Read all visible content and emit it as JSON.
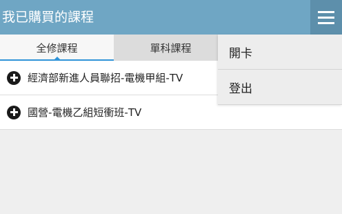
{
  "appbar": {
    "title": "我已購買的課程",
    "menu_icon": "hamburger-menu-icon"
  },
  "tabs": [
    {
      "label": "全修課程",
      "active": true
    },
    {
      "label": "單科課程",
      "active": false
    }
  ],
  "courses": [
    {
      "icon": "plus-circle-icon",
      "title": "經濟部新進人員聯招-電機甲組-TV"
    },
    {
      "icon": "plus-circle-icon",
      "title": "國營-電機乙組短衝班-TV"
    }
  ],
  "menu": {
    "items": [
      {
        "label": "開卡"
      },
      {
        "label": "登出"
      }
    ]
  },
  "colors": {
    "appbar": "#6fa6c4",
    "menu_button": "#5d8fab",
    "tab_indicator": "#2f93d8",
    "background": "#efefef"
  }
}
